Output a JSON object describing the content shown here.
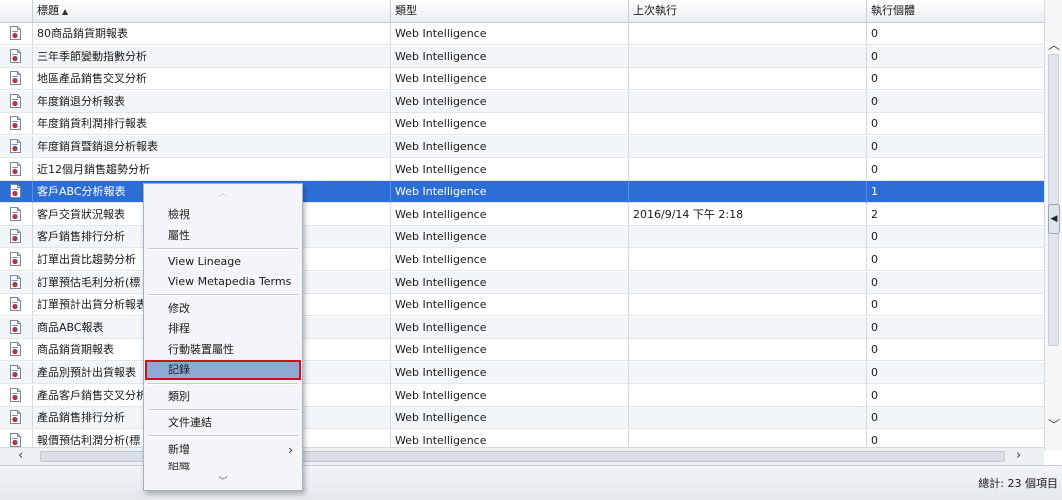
{
  "columns": {
    "title": "標題",
    "sort_indicator": "▲",
    "type": "類型",
    "last_run": "上次執行",
    "instances": "執行個體"
  },
  "rows": [
    {
      "title": "80商品銷貨期報表",
      "type": "Web Intelligence",
      "last_run": "",
      "instances": "0"
    },
    {
      "title": "三年季節變動指數分析",
      "type": "Web Intelligence",
      "last_run": "",
      "instances": "0"
    },
    {
      "title": "地區產品銷售交叉分析",
      "type": "Web Intelligence",
      "last_run": "",
      "instances": "0"
    },
    {
      "title": "年度銷退分析報表",
      "type": "Web Intelligence",
      "last_run": "",
      "instances": "0"
    },
    {
      "title": "年度銷貨利潤排行報表",
      "type": "Web Intelligence",
      "last_run": "",
      "instances": "0"
    },
    {
      "title": "年度銷貨暨銷退分析報表",
      "type": "Web Intelligence",
      "last_run": "",
      "instances": "0"
    },
    {
      "title": "近12個月銷售趨勢分析",
      "type": "Web Intelligence",
      "last_run": "",
      "instances": "0"
    },
    {
      "title": "客戶ABC分析報表",
      "type": "Web Intelligence",
      "last_run": "",
      "instances": "1"
    },
    {
      "title": "客戶交貨狀況報表",
      "type": "Web Intelligence",
      "last_run": "2016/9/14 下午 2:18",
      "instances": "2"
    },
    {
      "title": "客戶銷售排行分析",
      "type": "Web Intelligence",
      "last_run": "",
      "instances": "0"
    },
    {
      "title": "訂單出貨比趨勢分析",
      "type": "Web Intelligence",
      "last_run": "",
      "instances": "0"
    },
    {
      "title": "訂單預估毛利分析(標",
      "type": "Web Intelligence",
      "last_run": "",
      "instances": "0"
    },
    {
      "title": "訂單預計出貨分析報表",
      "type": "Web Intelligence",
      "last_run": "",
      "instances": "0"
    },
    {
      "title": "商品ABC報表",
      "type": "Web Intelligence",
      "last_run": "",
      "instances": "0"
    },
    {
      "title": "商品銷貨期報表",
      "type": "Web Intelligence",
      "last_run": "",
      "instances": "0"
    },
    {
      "title": "產品別預計出貨報表",
      "type": "Web Intelligence",
      "last_run": "",
      "instances": "0"
    },
    {
      "title": "產品客戶銷售交叉分析",
      "type": "Web Intelligence",
      "last_run": "",
      "instances": "0"
    },
    {
      "title": "產品銷售排行分析",
      "type": "Web Intelligence",
      "last_run": "",
      "instances": "0"
    },
    {
      "title": "報價預估利潤分析(標",
      "type": "Web Intelligence",
      "last_run": "",
      "instances": "0"
    }
  ],
  "context_menu": {
    "view": "檢視",
    "properties": "屬性",
    "view_lineage": "View Lineage",
    "view_metapedia_terms": "View Metapedia Terms",
    "modify": "修改",
    "schedule": "排程",
    "mobile_properties": "行動裝置屬性",
    "history": "記錄",
    "categories": "類別",
    "document_link": "文件連結",
    "new": "新增",
    "cut_off_item": "組織",
    "sub_arrow": "›",
    "scroll_up": "︿",
    "scroll_down": "﹀"
  },
  "status": {
    "total": "總計: 23 個項目"
  },
  "scroll": {
    "up": "︿",
    "down": "﹀",
    "left": "‹",
    "right": "›",
    "panel_toggle": "◀"
  },
  "selected_row_index": 7,
  "icons": {
    "row_icon": "webi-document-icon"
  },
  "colors": {
    "selection": "#2c6ed5",
    "highlight_border": "#d0101a"
  }
}
